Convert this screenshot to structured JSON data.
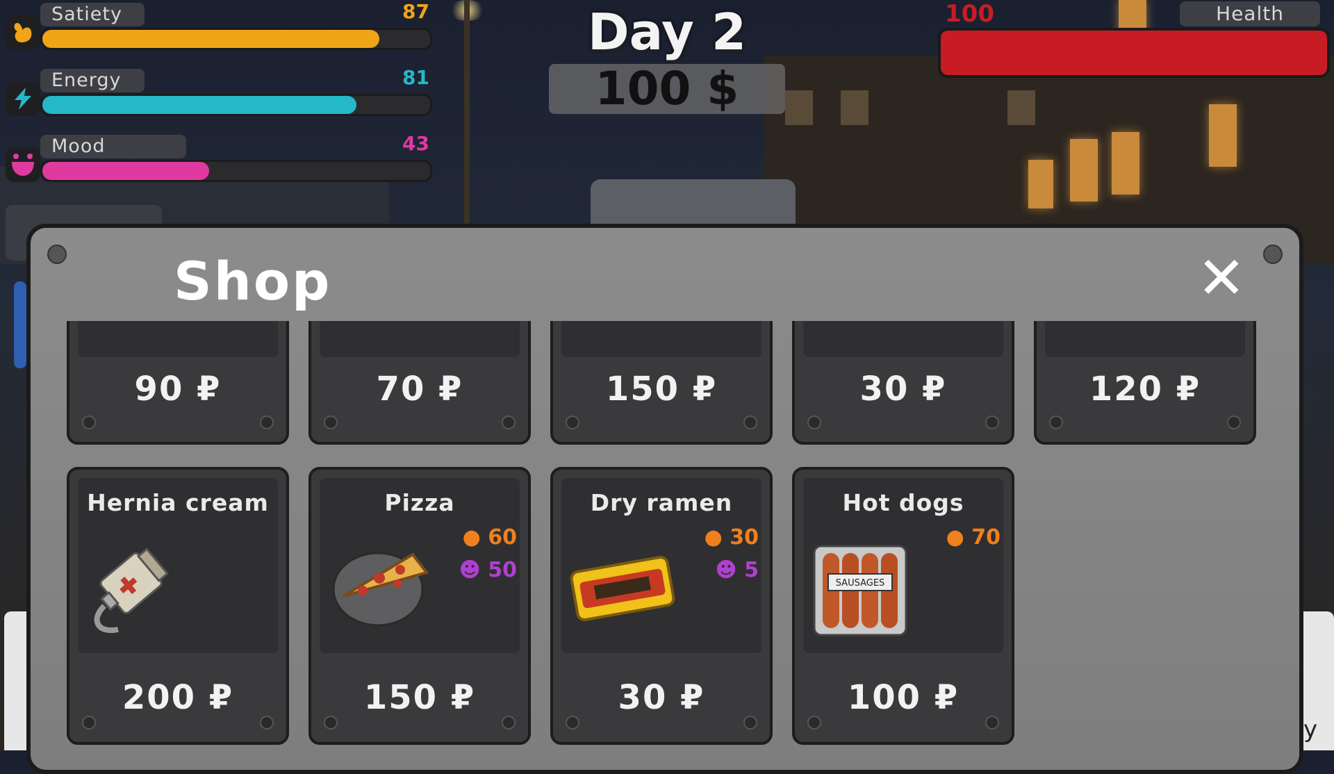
{
  "hud": {
    "satiety": {
      "label": "Satiety",
      "value": "87",
      "fraction": 0.87,
      "color": "#f0a418",
      "icon": "stomach-icon"
    },
    "energy": {
      "label": "Energy",
      "value": "81",
      "fraction": 0.81,
      "color": "#25b8c8",
      "icon": "lightning-icon"
    },
    "mood": {
      "label": "Mood",
      "value": "43",
      "fraction": 0.43,
      "color": "#e03aa0",
      "icon": "smile-icon"
    },
    "day": "Day 2",
    "money": "100 $",
    "health": {
      "label": "Health",
      "value": "100",
      "fraction": 1.0,
      "color": "#c81c24"
    }
  },
  "right_partial_text": "ry",
  "shop": {
    "title": "Shop",
    "close_icon": "close-icon",
    "row1": [
      {
        "price": "90 ₽"
      },
      {
        "price": "70 ₽"
      },
      {
        "price": "150 ₽"
      },
      {
        "price": "30 ₽"
      },
      {
        "price": "120 ₽"
      }
    ],
    "row2": [
      {
        "name": "Hernia cream",
        "price": "200 ₽",
        "icon": "ointment-tube-icon",
        "satiety": "",
        "mood": ""
      },
      {
        "name": "Pizza",
        "price": "150 ₽",
        "icon": "pizza-icon",
        "satiety": "60",
        "mood": "50"
      },
      {
        "name": "Dry ramen",
        "price": "30 ₽",
        "icon": "ramen-icon",
        "satiety": "30",
        "mood": "5"
      },
      {
        "name": "Hot dogs",
        "price": "100 ₽",
        "icon": "sausages-icon",
        "satiety": "70",
        "mood": ""
      }
    ],
    "sausage_pack_text": "SAUSAGES"
  }
}
